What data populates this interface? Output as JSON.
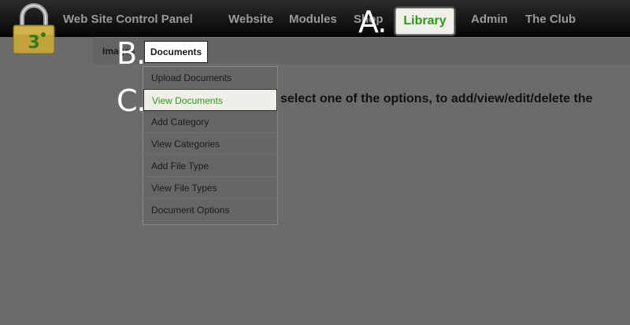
{
  "header": {
    "app_title": "Web Site Control Panel",
    "nav": [
      {
        "label": "Website"
      },
      {
        "label": "Modules"
      },
      {
        "label": "Shop"
      },
      {
        "label": "Library"
      },
      {
        "label": "Admin"
      },
      {
        "label": "The Club"
      }
    ],
    "active_nav": "Library"
  },
  "subnav": {
    "items": [
      {
        "label": "Images"
      },
      {
        "label": "Documents"
      }
    ],
    "active": "Documents"
  },
  "dropdown": {
    "items": [
      {
        "label": "Upload Documents"
      },
      {
        "label": "View Documents"
      },
      {
        "label": "Add Category"
      },
      {
        "label": "View Categories"
      },
      {
        "label": "Add File Type"
      },
      {
        "label": "View File Types"
      },
      {
        "label": "Document Options"
      }
    ],
    "selected": "View Documents"
  },
  "main": {
    "instruction": "select one of the options, to add/view/edit/delete the"
  },
  "annotations": {
    "a": "A.",
    "b": "B.",
    "c": "C."
  },
  "colors": {
    "accent_green": "#2e9a18",
    "background": "#6b6b6b",
    "topbar": "#050505"
  },
  "icons": {
    "logo": "padlock-logo-icon"
  }
}
